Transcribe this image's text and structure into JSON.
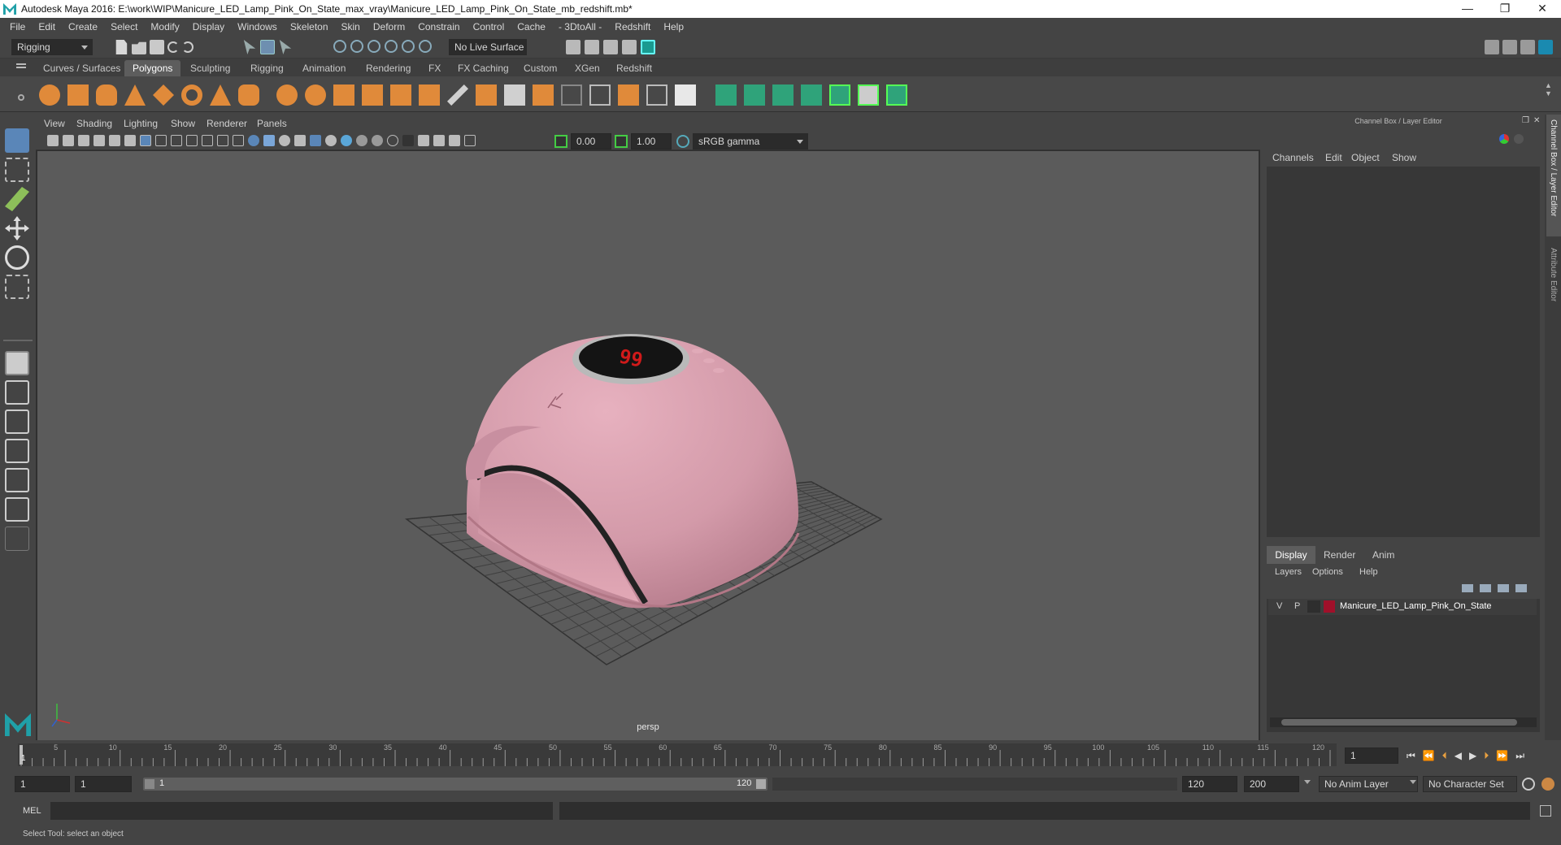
{
  "window": {
    "title": "Autodesk Maya 2016: E:\\work\\WIP\\Manicure_LED_Lamp_Pink_On_State_max_vray\\Manicure_LED_Lamp_Pink_On_State_mb_redshift.mb*",
    "minimize": "—",
    "restore": "❐",
    "close": "✕"
  },
  "menubar": [
    "File",
    "Edit",
    "Create",
    "Select",
    "Modify",
    "Display",
    "Windows",
    "Skeleton",
    "Skin",
    "Deform",
    "Constrain",
    "Control",
    "Cache",
    "- 3DtoAll -",
    "Redshift",
    "Help"
  ],
  "statusline": {
    "mode": "Rigging",
    "live_surface": "No Live Surface"
  },
  "shelf": {
    "tabs": [
      "Curves / Surfaces",
      "Polygons",
      "Sculpting",
      "Rigging",
      "Animation",
      "Rendering",
      "FX",
      "FX Caching",
      "Custom",
      "XGen",
      "Redshift"
    ],
    "active_tab": "Polygons"
  },
  "viewport": {
    "menu": [
      "View",
      "Shading",
      "Lighting",
      "Show",
      "Renderer",
      "Panels"
    ],
    "exposure": "0.00",
    "gamma": "1.00",
    "color_space": "sRGB gamma",
    "camera_label": "persp",
    "display_digits": "99"
  },
  "channel_box": {
    "header": "Channel Box / Layer Editor",
    "menu": [
      "Channels",
      "Edit",
      "Object",
      "Show"
    ],
    "side_tabs": [
      "Channel Box / Layer Editor",
      "Attribute Editor"
    ]
  },
  "layer_editor": {
    "tabs": [
      "Display",
      "Render",
      "Anim"
    ],
    "active_tab": "Display",
    "menu": [
      "Layers",
      "Options",
      "Help"
    ],
    "layers": [
      {
        "v": "V",
        "p": "P",
        "name": "Manicure_LED_Lamp_Pink_On_State",
        "color": "#a0102a"
      }
    ]
  },
  "timeline": {
    "ticks": [
      "5",
      "10",
      "15",
      "20",
      "25",
      "30",
      "35",
      "40",
      "45",
      "50",
      "55",
      "60",
      "65",
      "70",
      "75",
      "80",
      "85",
      "90",
      "95",
      "100",
      "105",
      "110",
      "115",
      "120"
    ],
    "start_tick": "1",
    "current_frame": "1"
  },
  "range": {
    "start": "1",
    "current": "1",
    "slider_start": "1",
    "slider_end": "120",
    "end": "120",
    "anim_end": "200",
    "anim_layer": "No Anim Layer",
    "character_set": "No Character Set"
  },
  "mel": {
    "label": "MEL"
  },
  "helpline": "Select Tool: select an object",
  "colors": {
    "accent": "#1fa0a8",
    "shelf_green": "#2fa37a",
    "lamp_pink": "#d59aaa"
  }
}
